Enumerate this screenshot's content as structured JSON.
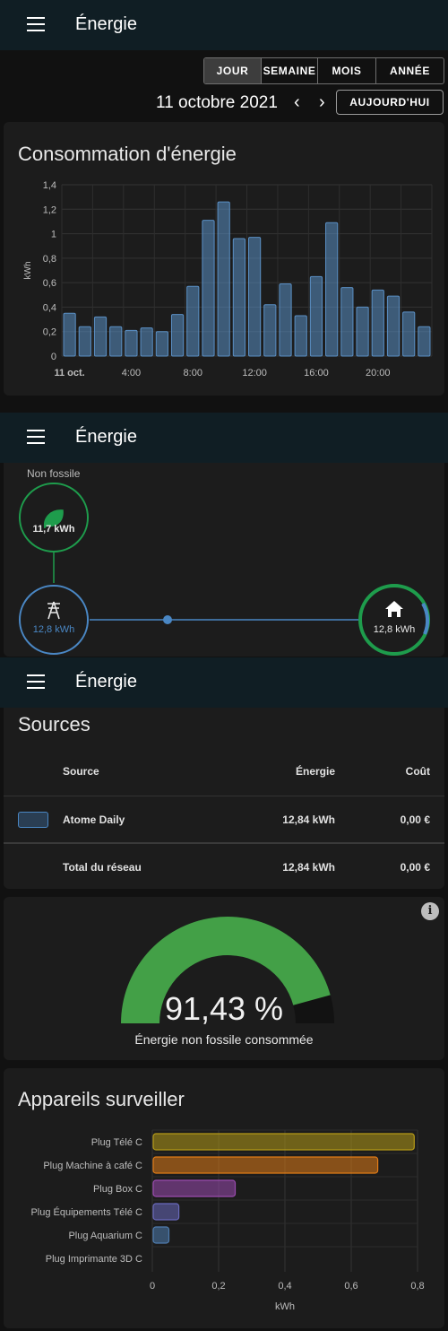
{
  "app": {
    "title": "Énergie"
  },
  "period_tabs": [
    "JOUR",
    "SEMAINE",
    "MOIS",
    "ANNÉE"
  ],
  "date_nav": {
    "date": "11 octobre 2021",
    "prev": "‹",
    "next": "›",
    "today_label": "AUJOURD'HUI"
  },
  "consumption": {
    "title": "Consommation d'énergie",
    "chart_data": {
      "type": "bar",
      "ylabel": "kWh",
      "ylim": [
        0,
        1.4
      ],
      "yticks": [
        "0",
        "0,2",
        "0,4",
        "0,6",
        "0,8",
        "1",
        "1,2",
        "1,4"
      ],
      "xticks": [
        "11 oct.",
        "4:00",
        "8:00",
        "12:00",
        "16:00",
        "20:00"
      ],
      "hours": [
        0,
        1,
        2,
        3,
        4,
        5,
        6,
        7,
        8,
        9,
        10,
        11,
        12,
        13,
        14,
        15,
        16,
        17,
        18,
        19,
        20,
        21,
        22,
        23
      ],
      "values": [
        0.35,
        0.24,
        0.32,
        0.24,
        0.21,
        0.23,
        0.2,
        0.34,
        0.57,
        1.11,
        1.26,
        0.96,
        0.97,
        0.42,
        0.59,
        0.33,
        0.65,
        1.09,
        0.56,
        0.4,
        0.54,
        0.49,
        0.36,
        0.24
      ],
      "color": "#5a8fc4",
      "grid": true
    }
  },
  "flow": {
    "label_fossil": "Non fossile",
    "low_carbon_value": "11,7 kWh",
    "grid_value": "12,8 kWh",
    "home_value": "12,8 kWh",
    "colors": {
      "green": "#1e9c4c",
      "blue": "#4a87c4"
    }
  },
  "sources": {
    "title": "Sources",
    "headers": {
      "source": "Source",
      "energy": "Énergie",
      "cost": "Coût"
    },
    "rows": [
      {
        "name": "Atome Daily",
        "energy": "12,84 kWh",
        "cost": "0,00 €",
        "color": "#4a87c4"
      }
    ],
    "total": {
      "label": "Total du réseau",
      "energy": "12,84 kWh",
      "cost": "0,00 €"
    }
  },
  "gauge": {
    "value": 91.43,
    "value_label": "91,43 %",
    "caption": "Énergie non fossile consommée",
    "color": "#43a047"
  },
  "devices": {
    "title": "Appareils surveiller",
    "chart_data": {
      "type": "bar",
      "orientation": "horizontal",
      "categories": [
        "Plug Télé C",
        "Plug Machine à café C",
        "Plug Box C",
        "Plug Équipements Télé C",
        "Plug Aquarium C",
        "Plug Imprimante 3D C"
      ],
      "values": [
        0.79,
        0.68,
        0.25,
        0.08,
        0.05,
        0.0
      ],
      "colors": [
        "#b59a17",
        "#e07b17",
        "#9b4bb0",
        "#6a6abd",
        "#4f7db0",
        "#4f7db0"
      ],
      "xlabel": "kWh",
      "xlim": [
        0,
        0.8
      ],
      "xticks": [
        "0",
        "0,2",
        "0,4",
        "0,6",
        "0,8"
      ],
      "grid": true
    }
  }
}
